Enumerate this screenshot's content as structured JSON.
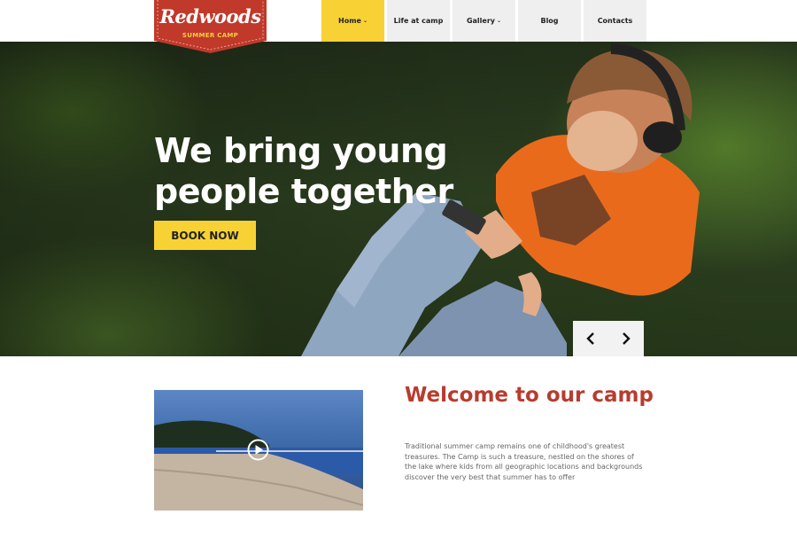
{
  "brand": {
    "name": "Redwoods",
    "tagline": "SUMMER CAMP",
    "colors": {
      "primary": "#c0392b",
      "accent": "#f8d234"
    }
  },
  "nav": {
    "items": [
      {
        "label": "Home",
        "dropdown": true,
        "active": true
      },
      {
        "label": "Life at camp",
        "dropdown": false,
        "active": false
      },
      {
        "label": "Gallery",
        "dropdown": true,
        "active": false
      },
      {
        "label": "Blog",
        "dropdown": false,
        "active": false
      },
      {
        "label": "Contacts",
        "dropdown": false,
        "active": false
      }
    ],
    "dropdown_icon": "chevron-down-icon"
  },
  "hero": {
    "title_line1": "We bring young",
    "title_line2": "people together",
    "cta_label": "BOOK NOW",
    "prev_icon": "chevron-left-icon",
    "next_icon": "chevron-right-icon"
  },
  "welcome": {
    "title": "Welcome to our camp",
    "text": "Traditional summer camp remains one of childhood's greatest treasures. The Camp is such a treasure, nestled on the shores of the lake where kids from all geographic locations and backgrounds discover the very best that summer has to offer",
    "video_icon": "play-icon"
  }
}
